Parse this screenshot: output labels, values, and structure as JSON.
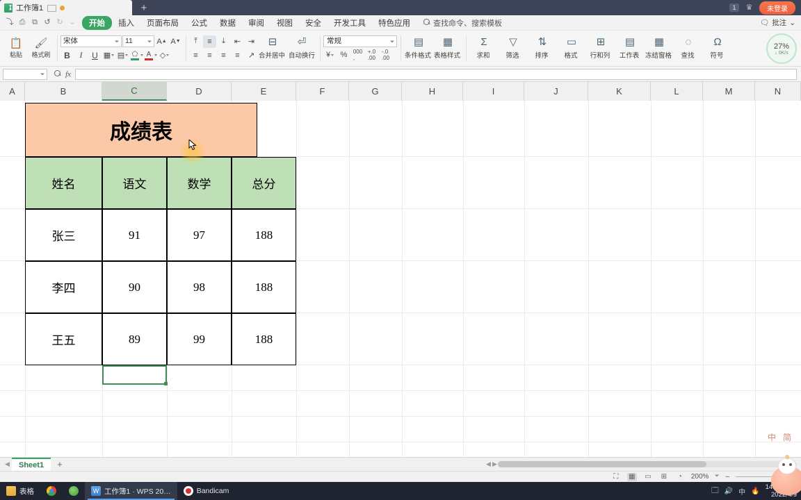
{
  "titlebar": {
    "doc_tab_label": "工作簿1",
    "new_tab_label": "+",
    "badge_count": "1",
    "crown_icon": "♛",
    "login_label": "未登录"
  },
  "ribbon_tabs": {
    "items": [
      "开始",
      "插入",
      "页面布局",
      "公式",
      "数据",
      "审阅",
      "视图",
      "安全",
      "开发工具",
      "特色应用"
    ],
    "active": "开始",
    "search_placeholder": "查找命令、搜索模板",
    "right_label": "批注",
    "qat": [
      "↷",
      "▭",
      "🔍",
      "↶",
      "↷",
      "⌄"
    ]
  },
  "ribbon": {
    "paste_label": "粘贴",
    "format_painter_label": "格式刷",
    "font_name": "宋体",
    "font_size": "11",
    "grow_font": "A",
    "shrink_font": "A",
    "bold": "B",
    "italic": "I",
    "underline": "U",
    "border_icon": "▦",
    "fill_icon": "▤",
    "font_color_icon": "A",
    "highlight_icon": "◇",
    "merge_label": "合并居中",
    "wrap_label": "自动换行",
    "number_format": "常规",
    "currency_icon": "¥",
    "percent_icon": "%",
    "comma_icon": "000",
    "inc_dec_icon": "+.0",
    "dec_dec_icon": ".00",
    "buttons": [
      {
        "icon": "▤",
        "label": "条件格式"
      },
      {
        "icon": "▦",
        "label": "表格样式"
      },
      {
        "icon": "Σ",
        "label": "求和"
      },
      {
        "icon": "▽",
        "label": "筛选"
      },
      {
        "icon": "⇅",
        "label": "排序"
      },
      {
        "icon": "▭",
        "label": "格式"
      },
      {
        "icon": "⊞",
        "label": "行和列"
      },
      {
        "icon": "▤",
        "label": "工作表"
      },
      {
        "icon": "▦",
        "label": "冻结窗格"
      },
      {
        "icon": "◌",
        "label": "查找"
      },
      {
        "icon": "Ω",
        "label": "符号"
      }
    ],
    "download_percent": "27%",
    "download_speed": "↓ 0K/s"
  },
  "formula_bar": {
    "name_box": "",
    "fx_label": "fx",
    "formula_value": ""
  },
  "grid": {
    "columns": [
      "A",
      "B",
      "C",
      "D",
      "E",
      "F",
      "G",
      "H",
      "I",
      "J",
      "K",
      "L",
      "M",
      "N"
    ],
    "selected_column": "C",
    "active_cell": "C7",
    "title_cell": "成绩表",
    "headers": [
      "姓名",
      "语文",
      "数学",
      "总分"
    ],
    "rows": [
      [
        "张三",
        "91",
        "97",
        "188"
      ],
      [
        "李四",
        "90",
        "98",
        "188"
      ],
      [
        "王五",
        "89",
        "99",
        "188"
      ]
    ],
    "title_fill": "#fbc8a8",
    "header_fill": "#bfe0b6",
    "selection_color": "#3f8c57"
  },
  "sheet_bar": {
    "tabs": [
      "Sheet1"
    ],
    "add_label": "+",
    "nav_left": "◀",
    "nav_right": "▶"
  },
  "status_bar": {
    "view_icons": [
      "⛶",
      "▦",
      "▭",
      "⊞",
      "◔"
    ],
    "zoom_label": "200%",
    "zoom_out": "–",
    "zoom_in": "+"
  },
  "overlays": {
    "ime": [
      "中",
      "简"
    ]
  },
  "taskbar": {
    "items": [
      {
        "icon": "folder",
        "label": "表格"
      },
      {
        "icon": "chrome",
        "label": ""
      },
      {
        "icon": "edge",
        "label": ""
      },
      {
        "icon": "wps",
        "label": "工作簿1 · WPS 20…",
        "active": true
      },
      {
        "icon": "bandicam",
        "label": "Bandicam"
      }
    ],
    "tray_icons": [
      "🗔",
      "🔊",
      "中",
      "🔥"
    ],
    "clock_time": "14:22 周六",
    "clock_date": "2022/4/9"
  }
}
